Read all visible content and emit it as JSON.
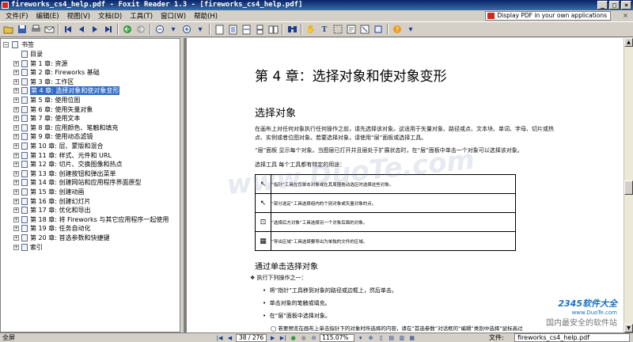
{
  "window": {
    "title": "fireworks_cs4_help.pdf - Foxit Reader 1.3 - [fireworks_cs4_help.pdf]",
    "buttons": [
      "_",
      "□",
      "×"
    ]
  },
  "menu": [
    "文件(F)",
    "编辑(E)",
    "视图(V)",
    "文档(D)",
    "工具(T)",
    "窗口(W)",
    "帮助(H)"
  ],
  "promo": "Display PDF in your own applications",
  "menu_close": "×",
  "toolbar": {
    "icons": [
      "open-icon",
      "save-icon",
      "print-icon",
      "email-icon",
      "first-page-icon",
      "prev-page-icon",
      "next-page-icon",
      "last-page-icon",
      "go-back-icon",
      "go-forward-icon",
      "zoom-out-icon",
      "zoom-in-icon",
      "actual-size-icon",
      "fit-page-icon",
      "fit-width-icon",
      "continuous-icon",
      "facing-icon",
      "find-icon",
      "hand-tool-icon",
      "text-select-icon",
      "snapshot-icon",
      "annotation-icon",
      "note-icon",
      "rotate-icon",
      "help-icon"
    ]
  },
  "bookmarks": {
    "root": "书签",
    "items": [
      {
        "label": "目录",
        "expandable": false
      },
      {
        "label": "第 1 章: 资源",
        "expandable": true
      },
      {
        "label": "第 2 章: Fireworks 基础",
        "expandable": true
      },
      {
        "label": "第 3 章: 工作区",
        "expandable": true
      },
      {
        "label": "第 4 章: 选择对象和使对象变形",
        "expandable": true,
        "selected": true
      },
      {
        "label": "第 5 章: 使用位图",
        "expandable": true
      },
      {
        "label": "第 6 章: 使用矢量对象",
        "expandable": true
      },
      {
        "label": "第 7 章: 使用文本",
        "expandable": true
      },
      {
        "label": "第 8 章: 应用颜色、笔触和填充",
        "expandable": true
      },
      {
        "label": "第 9 章: 使用动态滤镜",
        "expandable": true
      },
      {
        "label": "第 10 章: 层、蒙版和混合",
        "expandable": true
      },
      {
        "label": "第 11 章: 样式、元件和 URL",
        "expandable": true
      },
      {
        "label": "第 12 章: 切片、交换图像和热点",
        "expandable": true
      },
      {
        "label": "第 13 章: 创建按钮和弹出菜单",
        "expandable": true
      },
      {
        "label": "第 14 章: 创建网站和应用程序界面原型",
        "expandable": true
      },
      {
        "label": "第 15 章: 创建动画",
        "expandable": true
      },
      {
        "label": "第 16 章: 创建幻灯片",
        "expandable": true
      },
      {
        "label": "第 17 章: 优化和导出",
        "expandable": true
      },
      {
        "label": "第 18 章: 将 Fireworks 与其它应用程序一起使用",
        "expandable": true
      },
      {
        "label": "第 19 章: 任务自动化",
        "expandable": true
      },
      {
        "label": "第 20 章: 首选参数和快捷键",
        "expandable": true
      },
      {
        "label": "索引",
        "expandable": true
      }
    ]
  },
  "page": {
    "chapter_title": "第 4 章：选择对象和使对象变形",
    "section_title": "选择对象",
    "para1_l1": "在画布上对任何对象执行任何操作之前，请先选择该对象。这适用于矢量对象、路径或点、文本块、单词、字母、切片或热",
    "para1_l2": "点、实例或者位图对象。若要选择对象，请使用“层”面板或选择工具。",
    "para2": "“层”面板 显示每个对象。当图层已打开并且层处于扩展状态时，在“层”面板中单击一个对象可以选择该对象。",
    "tools_intro": "选择工具 每个工具都有特定的用途：",
    "tools_table": [
      {
        "icon": "pointer-tool-icon",
        "glyph": "↖",
        "text": "“指针”工具在您单击对象或在其周围拖动选区时选择这些对象。"
      },
      {
        "icon": "subselect-tool-icon",
        "glyph": "↖",
        "text": "“部分选定”工具选择组内的个别对象或矢量对象的点。"
      },
      {
        "icon": "select-behind-tool-icon",
        "glyph": "⊡",
        "text": "“选择后方对象”工具选择另一个对象后面的对象。"
      },
      {
        "icon": "export-area-tool-icon",
        "glyph": "▦",
        "text": "“导出区域”工具选择要导出为单独的文件的区域。"
      }
    ],
    "subsection_title": "通过单击选择对象",
    "step_lead": "执行下列操作之一：",
    "bullets": [
      "将“指针”工具移到对象的路径或边框上，然后单击。",
      "单击对象的笔触或填充。",
      "在“层”面板中选择对象。"
    ],
    "note": "若要预览在画布上单击指针下的对象时所选择的内容，请在“首选参数”对话框的“编辑”类别中选择“鼠标高过"
  },
  "watermark": "www.DuoTe.com",
  "logo": {
    "line1": "2345软件大全",
    "line2": "www.DuoTe.com",
    "line3": "国内最安全的软件站"
  },
  "status": {
    "left": "全屏",
    "page": "38 / 276",
    "zoom": "115.07%",
    "filename_label": "文件:",
    "filename": "fireworks_cs4_help.pdf"
  },
  "colors": {
    "selection": "#316ac5",
    "titlebar": "#0a246a"
  }
}
